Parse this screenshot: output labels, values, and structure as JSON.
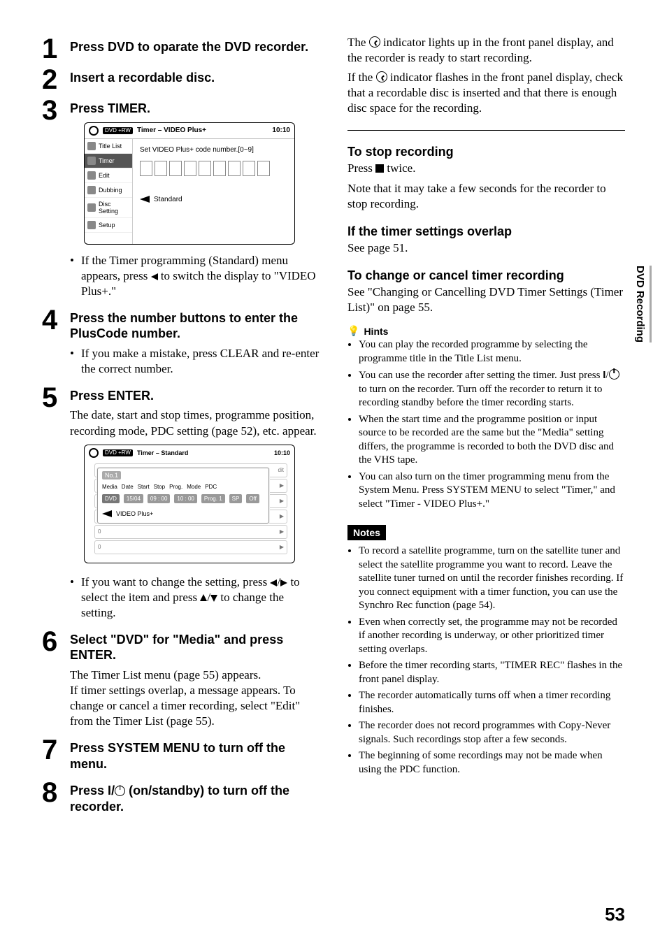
{
  "page_number": "53",
  "side_tab": "DVD Recording",
  "left": {
    "steps": [
      {
        "num": "1",
        "head": "Press DVD to oparate the DVD recorder."
      },
      {
        "num": "2",
        "head": "Insert a recordable disc."
      },
      {
        "num": "3",
        "head": "Press TIMER."
      },
      {
        "num": "4",
        "head": "Press the number buttons to enter the PlusCode number."
      },
      {
        "num": "5",
        "head": "Press ENTER."
      },
      {
        "num": "6",
        "head": "Select \"DVD\" for \"Media\" and press ENTER."
      },
      {
        "num": "7",
        "head": "Press SYSTEM MENU to turn off the menu."
      },
      {
        "num": "8",
        "head_prefix": "Press ",
        "head_mid": " (on/standby) to turn off the recorder."
      }
    ],
    "osd1": {
      "badge": "DVD +RW",
      "title": "Timer – VIDEO Plus+",
      "time": "10:10",
      "nav": [
        "Title List",
        "Timer",
        "Edit",
        "Dubbing",
        "Disc Setting",
        "Setup"
      ],
      "content_line": "Set VIDEO Plus+ code number.[0~9]",
      "standard": "Standard"
    },
    "after_osd1_bullet_a": "If the Timer programming (Standard) menu appears, press ",
    "after_osd1_bullet_b": " to switch the display to \"VIDEO Plus+.\"",
    "step4_bullet": "If you make a mistake, press CLEAR and re-enter the correct number.",
    "step5_desc": "The date, start and stop times, programme position, recording mode, PDC setting (page 52), etc. appear.",
    "osd2": {
      "badge": "DVD +RW",
      "title": "Timer – Standard",
      "time": "10:10",
      "no1": "No.1",
      "cols": [
        "Media",
        "Date",
        "Start",
        "Stop",
        "Prog.",
        "Mode",
        "PDC"
      ],
      "row": {
        "media": "DVD",
        "date": "15/04",
        "start": "09 : 00",
        "stop": "10 : 00",
        "prog": "Prog. 1",
        "mode": "SP",
        "pdc": "Off"
      },
      "side_label": "dit",
      "videoplus": "VIDEO Plus+"
    },
    "after_osd2_bullet_a": "If you want to change the setting, press ",
    "after_osd2_bullet_b": " to select the item and press ",
    "after_osd2_bullet_c": " to change the setting.",
    "step6_desc": "The Timer List menu (page 55) appears.\nIf timer settings overlap, a message appears. To change or cancel a timer recording, select \"Edit\" from the Timer List (page 55)."
  },
  "right": {
    "intro_a": "The ",
    "intro_b": " indicator lights up in the front panel display, and the recorder is ready to start recording.",
    "intro_c": "If the ",
    "intro_d": " indicator flashes in the front panel display, check that a recordable disc is inserted and that there is enough disc space for the recording.",
    "stop_head": "To stop recording",
    "stop_a": "Press ",
    "stop_b": " twice.",
    "stop_note": "Note that it may take a few seconds for the recorder to stop recording.",
    "overlap_head": "If the timer settings overlap",
    "overlap_text": "See page 51.",
    "change_head": "To change or cancel timer recording",
    "change_text": "See \"Changing or Cancelling DVD Timer Settings (Timer List)\"  on page 55.",
    "hints_head": "Hints",
    "hints": [
      "You can play the recorded programme by selecting the programme title in the Title List menu.",
      "You can use the recorder after setting the timer. Just press I/⏻ to turn on the recorder. Turn off the recorder to return it to recording standby before the timer recording starts.",
      "When the start time and the programme position or input source to be recorded are the same but the \"Media\" setting differs, the programme is recorded to both the DVD disc and the VHS tape.",
      "You can also turn on the timer programming menu from the System Menu. Press SYSTEM MENU to select \"Timer,\" and select \"Timer - VIDEO Plus+.\""
    ],
    "notes_head": "Notes",
    "notes": [
      "To record a satellite programme, turn on the satellite tuner and select the satellite programme you want to record. Leave the satellite tuner turned on until the recorder finishes recording. If you connect equipment with a timer function, you can use the Synchro Rec function (page 54).",
      "Even when correctly set, the programme may not be recorded if another recording is underway, or other prioritized timer setting overlaps.",
      "Before the timer recording starts, \"TIMER REC\" flashes in the front panel display.",
      "The recorder automatically turns off when a timer recording finishes.",
      "The recorder does not record programmes with Copy-Never signals. Such recordings stop after a few seconds.",
      "The beginning of some recordings may not be made when using the PDC function."
    ]
  },
  "hints_items_1_prefix": "You can use the recorder after setting the timer. Just press ",
  "hints_items_1_mid": " to turn on the recorder. Turn off the recorder to return it to recording standby before the timer recording starts."
}
